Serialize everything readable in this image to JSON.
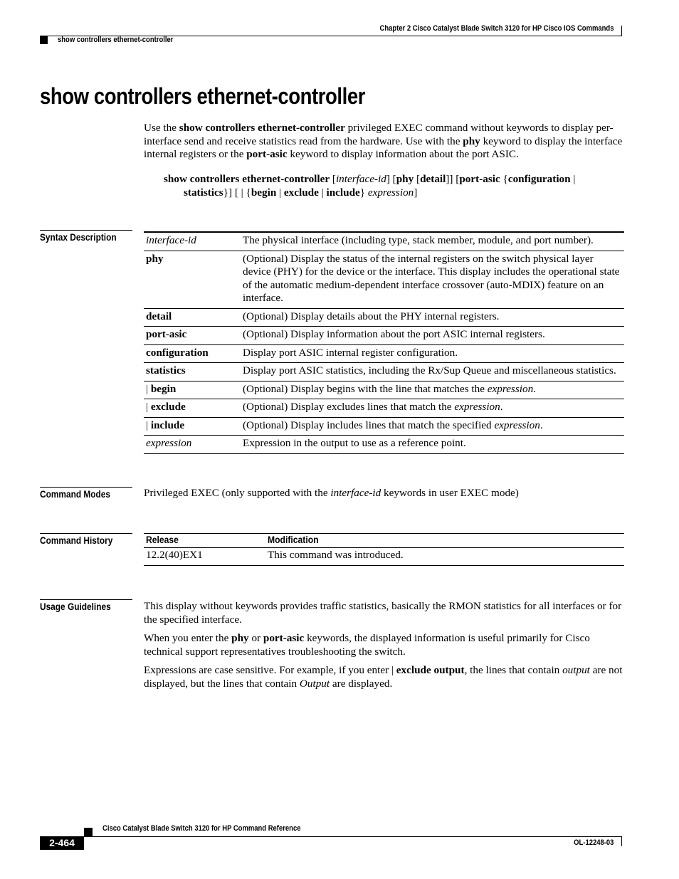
{
  "header": {
    "chapter": "Chapter 2 Cisco Catalyst Blade Switch 3120 for HP Cisco IOS Commands",
    "section": "show controllers ethernet-controller"
  },
  "title": "show controllers ethernet-controller",
  "intro": {
    "p1_a": "Use the ",
    "p1_b": "show controllers ethernet-controller",
    "p1_c": " privileged EXEC command without keywords to display per-interface send and receive statistics read from the hardware. Use with the ",
    "p1_d": "phy",
    "p1_e": " keyword to display the interface internal registers or the ",
    "p1_f": "port-asic",
    "p1_g": " keyword to display information about the port ASIC."
  },
  "syntax": {
    "cmd": "show controllers ethernet-controller",
    "s1": " [",
    "interface_id": "interface-id",
    "s2": "] [",
    "phy": "phy",
    "s3": " [",
    "detail": "detail",
    "s4": "]] [",
    "port_asic": "port-asic",
    "s5": " {",
    "configuration": "configuration",
    "s6": " |",
    "statistics": "statistics",
    "s7": "}] [ | {",
    "begin": "begin",
    "s8": " | ",
    "exclude": "exclude",
    "s9": " | ",
    "include": "include",
    "s10": "} ",
    "expression": "expression",
    "s11": "]"
  },
  "sections": {
    "syntax_description": "Syntax Description",
    "command_modes": "Command Modes",
    "command_history": "Command History",
    "usage_guidelines": "Usage Guidelines"
  },
  "syntax_table": [
    {
      "keyword": "interface-id",
      "style": "italic",
      "desc": [
        {
          "t": "The physical interface (including type, stack member, module, and port number)."
        }
      ]
    },
    {
      "keyword": "phy",
      "style": "bold",
      "desc": [
        {
          "t": "(Optional) Display the status of the internal registers on the switch physical layer device (PHY) for the device or the interface. This display includes the operational state of the automatic medium-dependent interface crossover (auto-MDIX) feature on an interface."
        }
      ]
    },
    {
      "keyword": "detail",
      "style": "bold",
      "desc": [
        {
          "t": "(Optional) Display details about the PHY internal registers."
        }
      ]
    },
    {
      "keyword": "port-asic",
      "style": "bold",
      "desc": [
        {
          "t": "(Optional) Display information about the port ASIC internal registers."
        }
      ]
    },
    {
      "keyword": "configuration",
      "style": "bold",
      "desc": [
        {
          "t": "Display port ASIC internal register configuration."
        }
      ]
    },
    {
      "keyword": "statistics",
      "style": "bold",
      "desc": [
        {
          "t": "Display port ASIC statistics, including the Rx/Sup Queue and miscellaneous statistics."
        }
      ]
    },
    {
      "keyword_prefix": "| ",
      "keyword": "begin",
      "style": "bold",
      "desc": [
        {
          "t": "(Optional) Display begins with the line that matches the "
        },
        {
          "t": "expression",
          "i": true
        },
        {
          "t": "."
        }
      ]
    },
    {
      "keyword_prefix": "| ",
      "keyword": "exclude",
      "style": "bold",
      "desc": [
        {
          "t": "(Optional) Display excludes lines that match the "
        },
        {
          "t": "expression",
          "i": true
        },
        {
          "t": "."
        }
      ]
    },
    {
      "keyword_prefix": "| ",
      "keyword": "include",
      "style": "bold",
      "desc": [
        {
          "t": "(Optional) Display includes lines that match the specified "
        },
        {
          "t": "expression",
          "i": true
        },
        {
          "t": "."
        }
      ]
    },
    {
      "keyword": "expression",
      "style": "italic",
      "desc": [
        {
          "t": "Expression in the output to use as a reference point."
        }
      ]
    }
  ],
  "command_modes": {
    "a": "Privileged EXEC (only supported with the ",
    "b": "interface-id",
    "c": " keywords in user EXEC mode)"
  },
  "history": {
    "headers": [
      "Release",
      "Modification"
    ],
    "rows": [
      [
        "12.2(40)EX1",
        "This command was introduced."
      ]
    ]
  },
  "usage": {
    "p1": "This display without keywords provides traffic statistics, basically the RMON statistics for all interfaces or for the specified interface.",
    "p2_a": "When you enter the ",
    "p2_b": "phy",
    "p2_c": " or ",
    "p2_d": "port-asic",
    "p2_e": " keywords, the displayed information is useful primarily for Cisco technical support representatives troubleshooting the switch.",
    "p3_a": "Expressions are case sensitive. For example, if you enter | ",
    "p3_b": "exclude output",
    "p3_c": ", the lines that contain ",
    "p3_d": "output",
    "p3_e": " are not displayed, but the lines that contain ",
    "p3_f": "Output",
    "p3_g": " are displayed."
  },
  "footer": {
    "title": "Cisco Catalyst Blade Switch 3120 for HP Command Reference",
    "page": "2-464",
    "doc_id": "OL-12248-03"
  }
}
